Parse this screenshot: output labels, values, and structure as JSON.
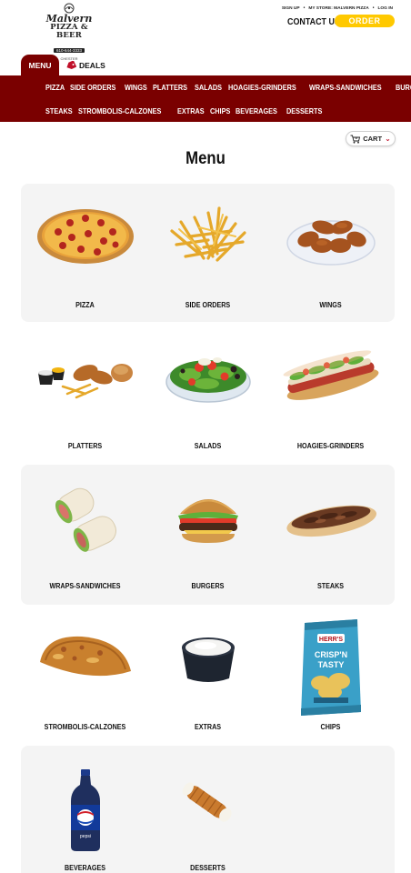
{
  "header": {
    "logo": {
      "script": "Malvern",
      "main": "PIZZA & BEER",
      "phone": "610-644-3333",
      "city": "CHESTER"
    },
    "top_links": [
      "SIGN UP",
      "MY STORE: MALVERN PIZZA",
      "LOG IN"
    ],
    "contact_label": "CONTACT US",
    "order_label": "ORDER"
  },
  "tabs": {
    "menu_label": "MENU",
    "deals_label": "DEALS"
  },
  "nav": {
    "row1": [
      "PIZZA",
      "SIDE ORDERS",
      "WINGS",
      "PLATTERS",
      "SALADS",
      "HOAGIES-GRINDERS",
      "WRAPS-SANDWICHES",
      "BURGERS"
    ],
    "row2": [
      "STEAKS",
      "STROMBOLIS-CALZONES",
      "EXTRAS",
      "CHIPS",
      "BEVERAGES",
      "DESSERTS"
    ]
  },
  "cart_label": "CART",
  "page_title": "Menu",
  "categories": [
    {
      "label": "PIZZA",
      "icon": "pizza-image"
    },
    {
      "label": "SIDE ORDERS",
      "icon": "fries-image"
    },
    {
      "label": "WINGS",
      "icon": "wings-image"
    },
    {
      "label": "PLATTERS",
      "icon": "platter-image"
    },
    {
      "label": "SALADS",
      "icon": "salad-image"
    },
    {
      "label": "HOAGIES-GRINDERS",
      "icon": "hoagie-image"
    },
    {
      "label": "WRAPS-SANDWICHES",
      "icon": "wrap-image"
    },
    {
      "label": "BURGERS",
      "icon": "burger-image"
    },
    {
      "label": "STEAKS",
      "icon": "steak-image"
    },
    {
      "label": "STROMBOLIS-CALZONES",
      "icon": "calzone-image"
    },
    {
      "label": "EXTRAS",
      "icon": "sauce-cup-image"
    },
    {
      "label": "CHIPS",
      "icon": "chips-bag-image"
    },
    {
      "label": "BEVERAGES",
      "icon": "soda-bottle-image"
    },
    {
      "label": "DESSERTS",
      "icon": "cannoli-image"
    }
  ],
  "chips_bag_text": {
    "brand": "HERR'S",
    "line1": "CRISP'N",
    "line2": "TASTY"
  },
  "soda_brand": "pepsi",
  "colors": {
    "brand_red": "#7a0000",
    "order_yellow": "#ffc900",
    "row_shade": "#f4f4f4",
    "accent_red": "#c0102a"
  }
}
